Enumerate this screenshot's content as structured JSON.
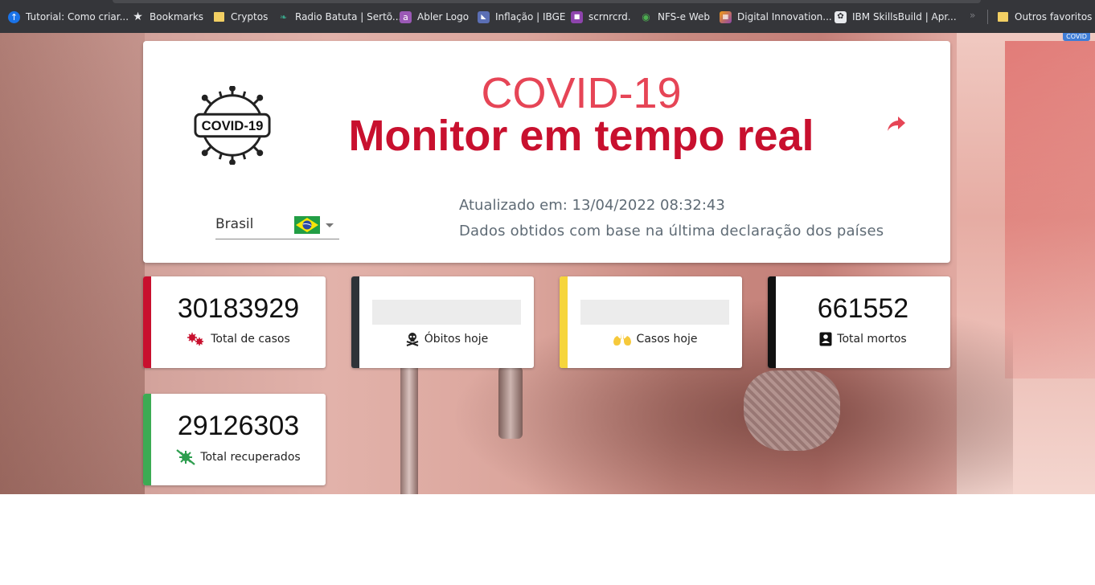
{
  "bookmarks": [
    {
      "label": "Tutorial: Como criar...",
      "icon": "arrow-up-icon"
    },
    {
      "label": "Bookmarks",
      "icon": "star-icon"
    },
    {
      "label": "Cryptos",
      "icon": "folder-icon"
    },
    {
      "label": "Radio Batuta | Sertõ...",
      "icon": "leaf-icon"
    },
    {
      "label": "Abler Logo",
      "icon": "abler-logo-icon"
    },
    {
      "label": "Inflação | IBGE",
      "icon": "ibge-icon"
    },
    {
      "label": "scrnrcrd.",
      "icon": "video-camera-icon"
    },
    {
      "label": "NFS-e Web",
      "icon": "globe-icon"
    },
    {
      "label": "Digital Innovation...",
      "icon": "dio-icon"
    },
    {
      "label": "IBM SkillsBuild | Apr...",
      "icon": "ibm-icon"
    },
    {
      "label": "Outros favoritos",
      "icon": "folder-icon"
    }
  ],
  "header": {
    "title_top": "COVID-19",
    "title_main": "Monitor em tempo real",
    "logo_text": "COVID-19",
    "country": "Brasil",
    "updated": "Atualizado em: 13/04/2022 08:32:43",
    "source": "Dados obtidos com base na última declaração dos países"
  },
  "stats": {
    "total_cases": {
      "value": "30183929",
      "label": "Total de casos",
      "color": "#c8102e"
    },
    "deaths_today": {
      "value": "",
      "label": "Óbitos hoje",
      "color": "#2e3338"
    },
    "cases_today": {
      "value": "",
      "label": "Casos hoje",
      "color": "#f6d53b"
    },
    "total_deaths": {
      "value": "661552",
      "label": "Total mortos",
      "color": "#111111"
    },
    "total_recovered": {
      "value": "29126303",
      "label": "Total recuperados",
      "color": "#3cab53"
    }
  },
  "colors": {
    "title_light": "#e64556",
    "title_dark": "#c8102e",
    "muted_text": "#5f6b75"
  }
}
